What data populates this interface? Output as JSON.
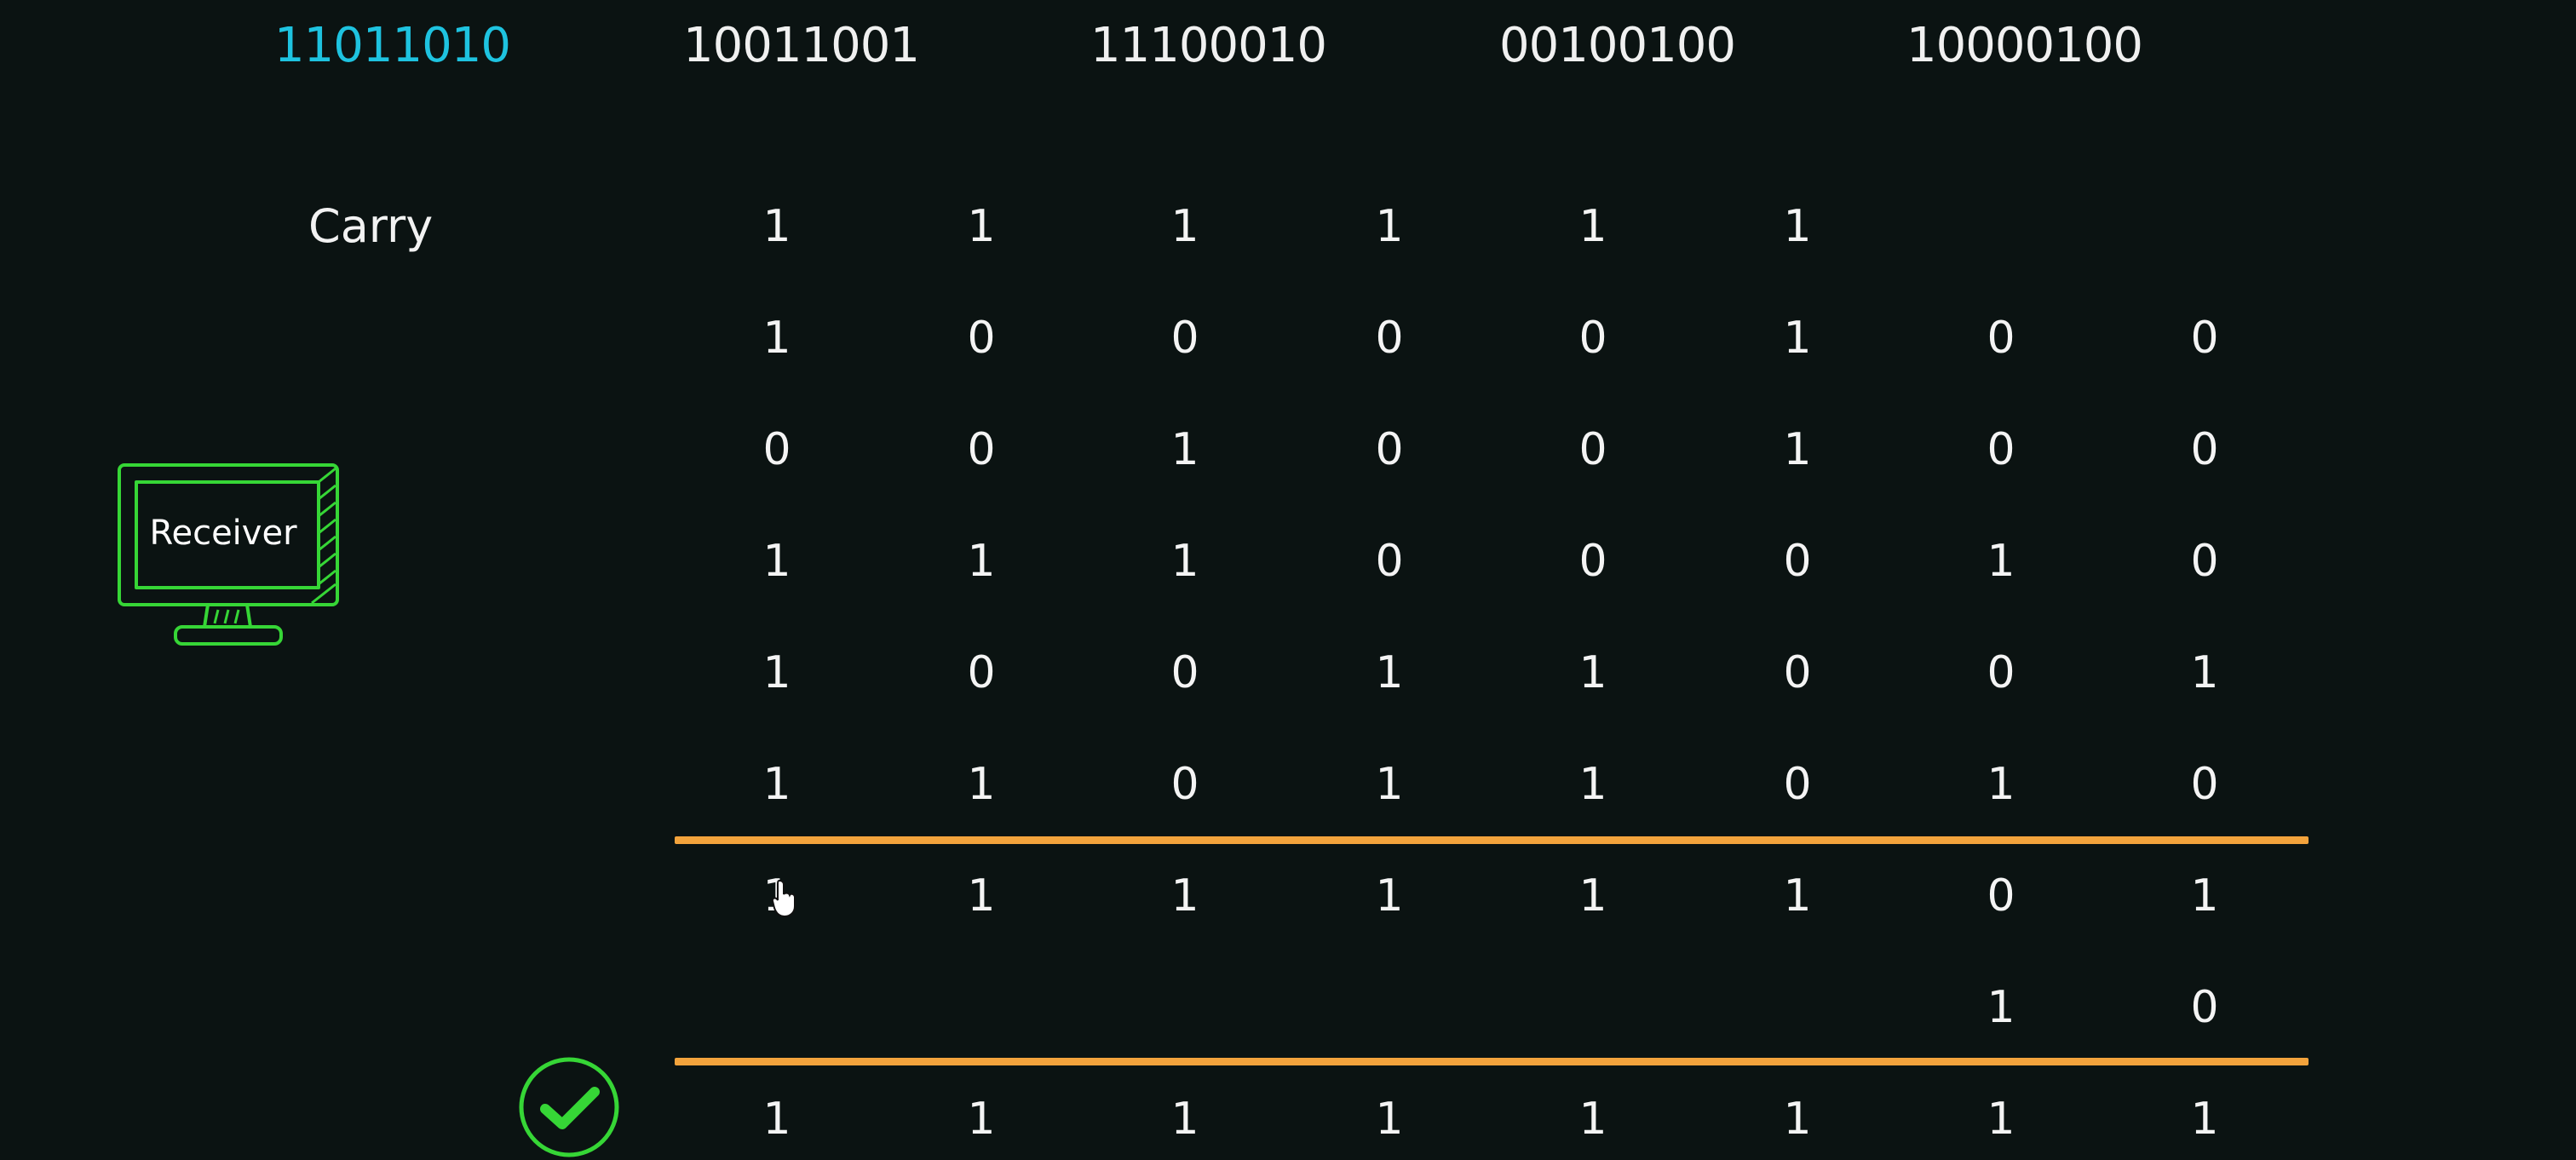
{
  "words": [
    "11011010",
    "10011001",
    "11100010",
    "00100100",
    "10000100"
  ],
  "active_word_index": 0,
  "carry_label": "Carry",
  "receiver_label": "Receiver",
  "carry_row": [
    "1",
    "1",
    "1",
    "1",
    "1",
    "1",
    "",
    ""
  ],
  "addend_rows": [
    [
      "1",
      "0",
      "0",
      "0",
      "0",
      "1",
      "0",
      "0"
    ],
    [
      "0",
      "0",
      "1",
      "0",
      "0",
      "1",
      "0",
      "0"
    ],
    [
      "1",
      "1",
      "1",
      "0",
      "0",
      "0",
      "1",
      "0"
    ],
    [
      "1",
      "0",
      "0",
      "1",
      "1",
      "0",
      "0",
      "1"
    ],
    [
      "1",
      "1",
      "0",
      "1",
      "1",
      "0",
      "1",
      "0"
    ]
  ],
  "sum_row": [
    "1",
    "1",
    "1",
    "1",
    "1",
    "1",
    "0",
    "1"
  ],
  "wraparound_row": [
    "",
    "",
    "",
    "",
    "",
    "",
    "1",
    "0"
  ],
  "result_row": [
    "1",
    "1",
    "1",
    "1",
    "1",
    "1",
    "1",
    "1"
  ],
  "colors": {
    "accent_word": "#1ec3e0",
    "rule": "#f3a33c",
    "receiver": "#36d636",
    "check": "#36d636"
  },
  "icons": {
    "receiver": "computer-monitor-icon",
    "status": "check-circle-icon",
    "pointer": "mouse-cursor-icon"
  }
}
